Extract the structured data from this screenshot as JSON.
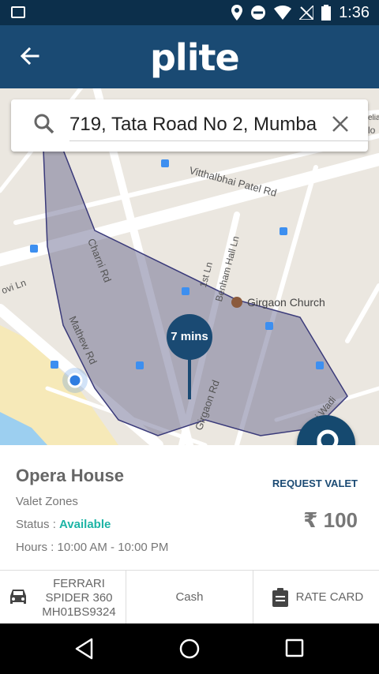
{
  "status_bar": {
    "time": "1:36"
  },
  "app": {
    "logo": "plite"
  },
  "search": {
    "value": "719, Tata Road No 2, Mumba"
  },
  "map": {
    "labels": [
      {
        "text": "Vitthalbhai Patel Rd"
      },
      {
        "text": "Charni Rd"
      },
      {
        "text": "1st Ln"
      },
      {
        "text": "Benham Hall Ln"
      },
      {
        "text": "Girgaon Church"
      },
      {
        "text": "Mathew Rd"
      },
      {
        "text": "Girgaon Rd"
      },
      {
        "text": "ovi Ln"
      },
      {
        "text": "ai Wadi"
      },
      {
        "text": "elia"
      },
      {
        "text": "lo"
      }
    ],
    "eta": "7 mins"
  },
  "fab": {
    "label": "REQUEST VALET"
  },
  "place": {
    "name": "Opera House",
    "type": "Valet Zones",
    "status_label": "Status : ",
    "status_value": "Available",
    "hours": "Hours : 10:00 AM - 10:00 PM",
    "price": "₹ 100"
  },
  "bottom": {
    "car": "FERRARI SPIDER 360 MH01BS9324",
    "car_lines": [
      "FERRARI",
      "SPIDER 360",
      "MH01BS9324"
    ],
    "payment": "Cash",
    "rate_card": "RATE CARD"
  },
  "colors": {
    "primary": "#1a4a73",
    "status_bar": "#0c2f4b",
    "available": "#1db4a5"
  }
}
